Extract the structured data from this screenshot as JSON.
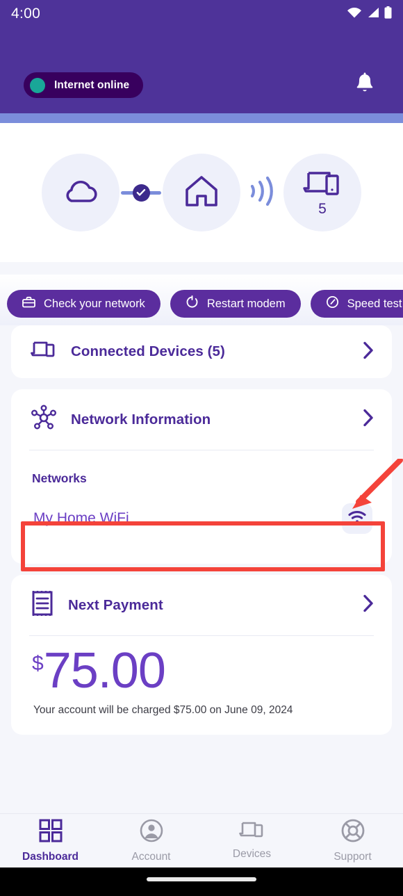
{
  "status_bar": {
    "time": "4:00",
    "icons": [
      "wifi-icon",
      "cellular-signal-icon",
      "battery-icon"
    ]
  },
  "header": {
    "connection_status": "Internet online",
    "status_dot_color": "#19a798",
    "pill_bg": "#38005e",
    "bg_color": "#4e3399",
    "notification_icon": "bell-icon"
  },
  "diagram": {
    "nodes": [
      {
        "icon": "cloud-icon",
        "label": ""
      },
      {
        "icon": "home-icon",
        "label": ""
      },
      {
        "icon": "devices-icon",
        "label": "5"
      }
    ],
    "link_icon": "check-circle-icon",
    "wireless_icon": "wifi-waves-icon"
  },
  "actions": [
    {
      "label": "Check your network",
      "icon": "toolbox-icon"
    },
    {
      "label": "Restart modem",
      "icon": "restart-icon"
    },
    {
      "label": "Speed test",
      "icon": "speedometer-icon"
    }
  ],
  "cards": {
    "connected_devices": {
      "title": "Connected Devices (5)",
      "icon": "devices-icon",
      "chevron": "chevron-right-icon"
    },
    "network_information": {
      "title": "Network Information",
      "icon": "network-hub-icon",
      "chevron": "chevron-right-icon",
      "networks_label": "Networks",
      "networks": [
        {
          "name": "My Home WiFi",
          "icon": "wifi-icon"
        }
      ]
    },
    "next_payment": {
      "title": "Next Payment",
      "icon": "receipt-icon",
      "chevron": "chevron-right-icon",
      "currency": "$",
      "amount": "75.00",
      "note": "Your account will be charged $75.00 on June 09, 2024"
    }
  },
  "annotation": {
    "highlight_color": "#f4433a",
    "target": "My Home WiFi"
  },
  "bottom_nav": {
    "items": [
      {
        "label": "Dashboard",
        "icon": "grid-icon",
        "active": true
      },
      {
        "label": "Account",
        "icon": "person-icon",
        "active": false
      },
      {
        "label": "Devices",
        "icon": "devices-icon",
        "active": false
      },
      {
        "label": "Support",
        "icon": "lifebuoy-icon",
        "active": false
      }
    ]
  },
  "theme": {
    "primary_purple": "#4b2a99",
    "button_purple": "#5b2d9e",
    "accent_blue": "#7b8ddb",
    "page_bg": "#f5f6fb"
  }
}
